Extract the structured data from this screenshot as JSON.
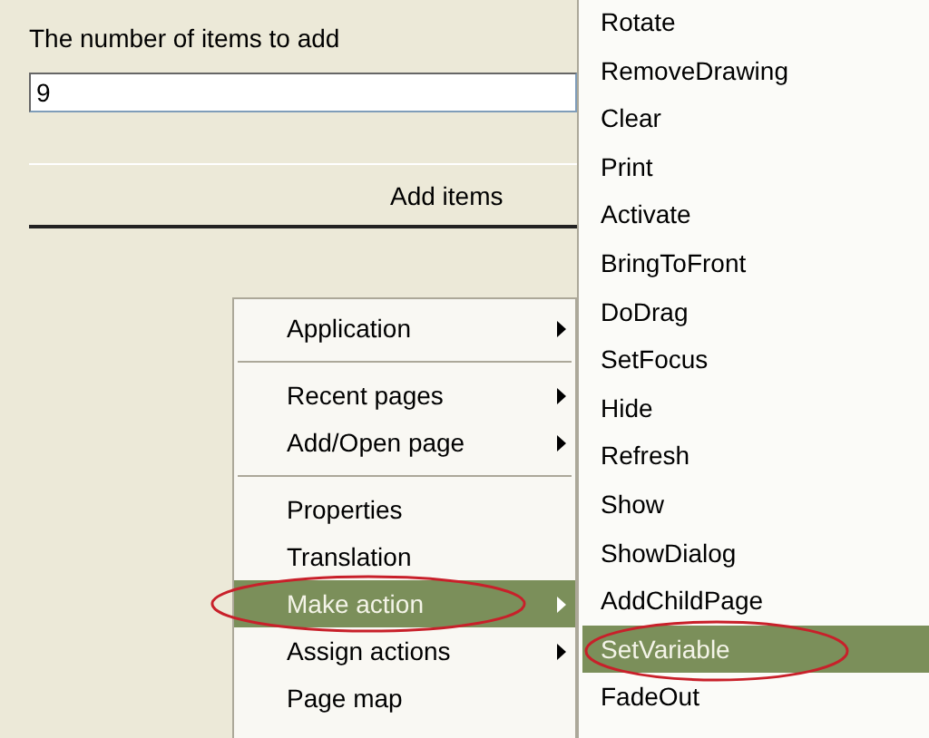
{
  "form": {
    "label": "The number of items to add",
    "value": "9",
    "button": "Add items"
  },
  "context_menu": {
    "groups": [
      [
        {
          "label": "Application",
          "submenu": true,
          "selected": false,
          "circled": false
        }
      ],
      [
        {
          "label": "Recent pages",
          "submenu": true,
          "selected": false,
          "circled": false
        },
        {
          "label": "Add/Open page",
          "submenu": true,
          "selected": false,
          "circled": false
        }
      ],
      [
        {
          "label": "Properties",
          "submenu": false,
          "selected": false,
          "circled": false
        },
        {
          "label": "Translation",
          "submenu": false,
          "selected": false,
          "circled": false
        },
        {
          "label": "Make action",
          "submenu": true,
          "selected": true,
          "circled": true
        },
        {
          "label": "Assign actions",
          "submenu": true,
          "selected": false,
          "circled": false
        },
        {
          "label": "Page map",
          "submenu": false,
          "selected": false,
          "circled": false
        }
      ]
    ]
  },
  "submenu": {
    "items": [
      {
        "label": "Rotate",
        "selected": false,
        "circled": false
      },
      {
        "label": "RemoveDrawing",
        "selected": false,
        "circled": false
      },
      {
        "label": "Clear",
        "selected": false,
        "circled": false
      },
      {
        "label": "Print",
        "selected": false,
        "circled": false
      },
      {
        "label": "Activate",
        "selected": false,
        "circled": false
      },
      {
        "label": "BringToFront",
        "selected": false,
        "circled": false
      },
      {
        "label": "DoDrag",
        "selected": false,
        "circled": false
      },
      {
        "label": "SetFocus",
        "selected": false,
        "circled": false
      },
      {
        "label": "Hide",
        "selected": false,
        "circled": false
      },
      {
        "label": "Refresh",
        "selected": false,
        "circled": false
      },
      {
        "label": "Show",
        "selected": false,
        "circled": false
      },
      {
        "label": "ShowDialog",
        "selected": false,
        "circled": false
      },
      {
        "label": "AddChildPage",
        "selected": false,
        "circled": false
      },
      {
        "label": "SetVariable",
        "selected": true,
        "circled": true
      },
      {
        "label": "FadeOut",
        "selected": false,
        "circled": false
      }
    ]
  }
}
